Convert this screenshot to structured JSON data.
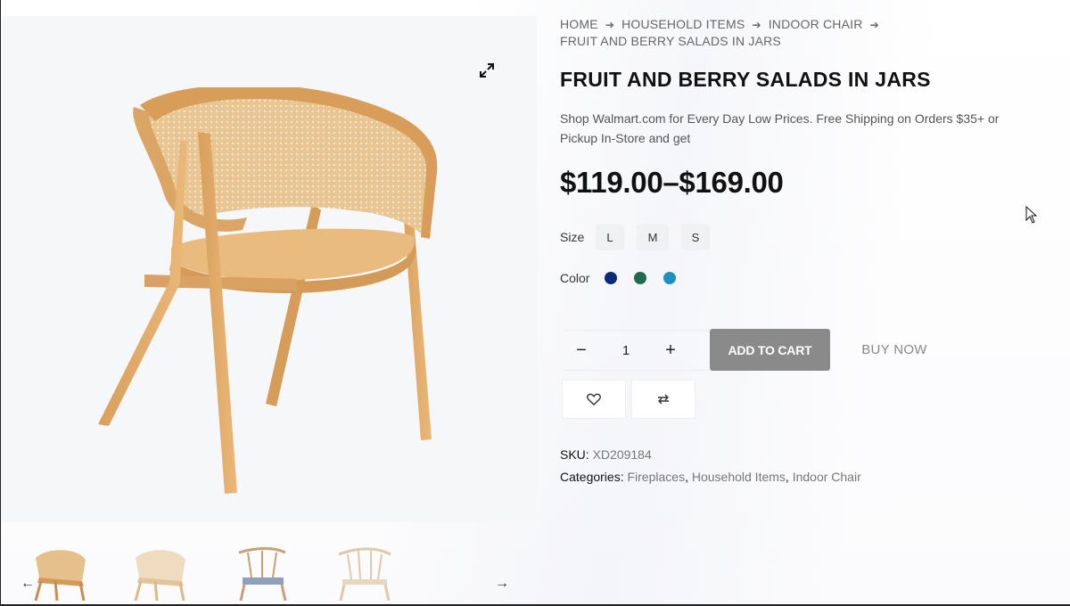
{
  "breadcrumb": {
    "items": [
      "HOME",
      "HOUSEHOLD ITEMS",
      "INDOOR CHAIR"
    ],
    "current": "FRUIT AND BERRY SALADS IN JARS",
    "separator_icon": "arrow-right-icon"
  },
  "product": {
    "title": "FRUIT AND BERRY SALADS IN JARS",
    "description": "Shop Walmart.com for Every Day Low Prices. Free Shipping on Orders $35+ or Pickup In-Store and get",
    "price": "$119.00–$169.00"
  },
  "options": {
    "size_label": "Size",
    "sizes": [
      "L",
      "M",
      "S"
    ],
    "color_label": "Color",
    "colors": [
      "#0d2a78",
      "#1e6b4f",
      "#1f8fc0"
    ]
  },
  "cart": {
    "minus": "−",
    "quantity": "1",
    "plus": "+",
    "add_to_cart": "ADD TO CART",
    "buy_now": "BUY NOW"
  },
  "actions": {
    "wishlist_icon": "heart-icon",
    "compare_icon": "compare-arrows-icon"
  },
  "meta": {
    "sku_label": "SKU:",
    "sku_value": "XD209184",
    "categories_label": "Categories:",
    "categories": [
      "Fireplaces",
      "Household Items",
      "Indoor Chair"
    ]
  },
  "gallery": {
    "zoom_icon": "expand-icon",
    "thumb_prev_icon": "arrow-left-icon",
    "thumb_next_icon": "arrow-right-icon",
    "thumb_count": 4
  }
}
